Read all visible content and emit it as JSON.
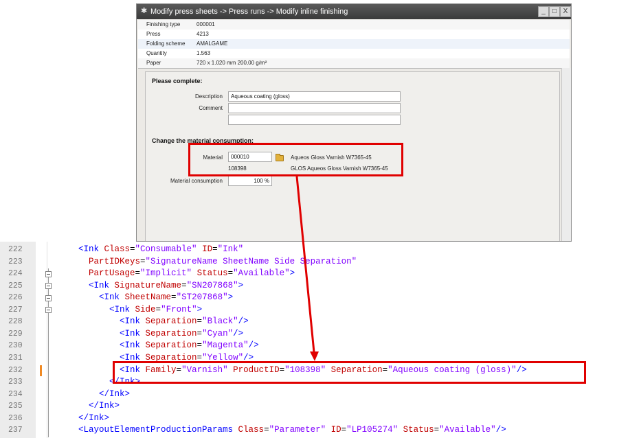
{
  "window": {
    "title": "Modify press sheets -> Press runs -> Modify inline finishing",
    "minimize_label": "_",
    "maximize_label": "□",
    "close_label": "X"
  },
  "info_rows": [
    {
      "label": "Finishing type",
      "value": "000001"
    },
    {
      "label": "Press",
      "value": "4213"
    },
    {
      "label": "Folding scheme",
      "value": "AMALGAME"
    },
    {
      "label": "Quantity",
      "value": "1.563"
    },
    {
      "label": "Paper",
      "value": "720 x 1.020 mm    200,00 g/m²"
    }
  ],
  "form": {
    "heading_complete": "Please complete:",
    "description_label": "Description",
    "description_value": "Aqueous coating (gloss)",
    "comment_label": "Comment",
    "comment_value_1": "",
    "comment_value_2": "",
    "heading_material": "Change the material consumption:",
    "material_label": "Material",
    "material_code": "000010",
    "material_name": "Aqueos Gloss Varnish W7365-45",
    "material_product_id": "108398",
    "material_product_name": "GLOS Aqueos Gloss Varnish W7365-45",
    "consumption_label": "Material consumption",
    "consumption_value": "100 %"
  },
  "editor": {
    "line_numbers": [
      "222",
      "223",
      "224",
      "225",
      "226",
      "227",
      "228",
      "229",
      "230",
      "231",
      "232",
      "233",
      "234",
      "235",
      "236",
      "237"
    ],
    "lines": [
      {
        "indent": "",
        "tokens": [
          [
            "tag",
            "<Ink "
          ],
          [
            "attr",
            "Class"
          ],
          [
            "eq",
            "="
          ],
          [
            "str",
            "\"Consumable\""
          ],
          [
            "attr",
            " ID"
          ],
          [
            "eq",
            "="
          ],
          [
            "str",
            "\"Ink\""
          ]
        ]
      },
      {
        "indent": "  ",
        "tokens": [
          [
            "attr",
            "PartIDKeys"
          ],
          [
            "eq",
            "="
          ],
          [
            "str",
            "\"SignatureName SheetName Side Separation\""
          ]
        ]
      },
      {
        "indent": "  ",
        "tokens": [
          [
            "attr",
            "PartUsage"
          ],
          [
            "eq",
            "="
          ],
          [
            "str",
            "\"Implicit\""
          ],
          [
            "attr",
            " Status"
          ],
          [
            "eq",
            "="
          ],
          [
            "str",
            "\"Available\""
          ],
          [
            "tag",
            ">"
          ]
        ]
      },
      {
        "indent": "  ",
        "tokens": [
          [
            "tag",
            "<Ink "
          ],
          [
            "attr",
            "SignatureName"
          ],
          [
            "eq",
            "="
          ],
          [
            "str",
            "\"SN207868\""
          ],
          [
            "tag",
            ">"
          ]
        ]
      },
      {
        "indent": "    ",
        "tokens": [
          [
            "tag",
            "<Ink "
          ],
          [
            "attr",
            "SheetName"
          ],
          [
            "eq",
            "="
          ],
          [
            "str",
            "\"ST207868\""
          ],
          [
            "tag",
            ">"
          ]
        ]
      },
      {
        "indent": "      ",
        "tokens": [
          [
            "tag",
            "<Ink "
          ],
          [
            "attr",
            "Side"
          ],
          [
            "eq",
            "="
          ],
          [
            "str",
            "\"Front\""
          ],
          [
            "tag",
            ">"
          ]
        ]
      },
      {
        "indent": "        ",
        "tokens": [
          [
            "tag",
            "<Ink "
          ],
          [
            "attr",
            "Separation"
          ],
          [
            "eq",
            "="
          ],
          [
            "str",
            "\"Black\""
          ],
          [
            "tag",
            "/>"
          ]
        ]
      },
      {
        "indent": "        ",
        "tokens": [
          [
            "tag",
            "<Ink "
          ],
          [
            "attr",
            "Separation"
          ],
          [
            "eq",
            "="
          ],
          [
            "str",
            "\"Cyan\""
          ],
          [
            "tag",
            "/>"
          ]
        ]
      },
      {
        "indent": "        ",
        "tokens": [
          [
            "tag",
            "<Ink "
          ],
          [
            "attr",
            "Separation"
          ],
          [
            "eq",
            "="
          ],
          [
            "str",
            "\"Magenta\""
          ],
          [
            "tag",
            "/>"
          ]
        ]
      },
      {
        "indent": "        ",
        "tokens": [
          [
            "tag",
            "<Ink "
          ],
          [
            "attr",
            "Separation"
          ],
          [
            "eq",
            "="
          ],
          [
            "str",
            "\"Yellow\""
          ],
          [
            "tag",
            "/>"
          ]
        ]
      },
      {
        "indent": "        ",
        "tokens": [
          [
            "tag",
            "<Ink "
          ],
          [
            "attr",
            "Family"
          ],
          [
            "eq",
            "="
          ],
          [
            "str",
            "\"Varnish\""
          ],
          [
            "attr",
            " ProductID"
          ],
          [
            "eq",
            "="
          ],
          [
            "str",
            "\"108398\""
          ],
          [
            "attr",
            " Separation"
          ],
          [
            "eq",
            "="
          ],
          [
            "str",
            "\"Aqueous coating (gloss)\""
          ],
          [
            "tag",
            "/>"
          ]
        ]
      },
      {
        "indent": "      ",
        "tokens": [
          [
            "tag",
            "</Ink>"
          ]
        ]
      },
      {
        "indent": "    ",
        "tokens": [
          [
            "tag",
            "</Ink>"
          ]
        ]
      },
      {
        "indent": "  ",
        "tokens": [
          [
            "tag",
            "</Ink>"
          ]
        ]
      },
      {
        "indent": "",
        "tokens": [
          [
            "tag",
            "</Ink>"
          ]
        ]
      },
      {
        "indent": "",
        "tokens": [
          [
            "tag",
            "<LayoutElementProductionParams "
          ],
          [
            "attr",
            "Class"
          ],
          [
            "eq",
            "="
          ],
          [
            "str",
            "\"Parameter\""
          ],
          [
            "attr",
            " ID"
          ],
          [
            "eq",
            "="
          ],
          [
            "str",
            "\"LP105274\""
          ],
          [
            "attr",
            " Status"
          ],
          [
            "eq",
            "="
          ],
          [
            "str",
            "\"Available\""
          ],
          [
            "tag",
            "/>"
          ]
        ]
      }
    ]
  },
  "colors": {
    "annotation_red": "#e00000",
    "xml_tag": "#0000ff",
    "xml_attr": "#c00000",
    "xml_string": "#8000ff",
    "change_marker": "#f08a24"
  }
}
